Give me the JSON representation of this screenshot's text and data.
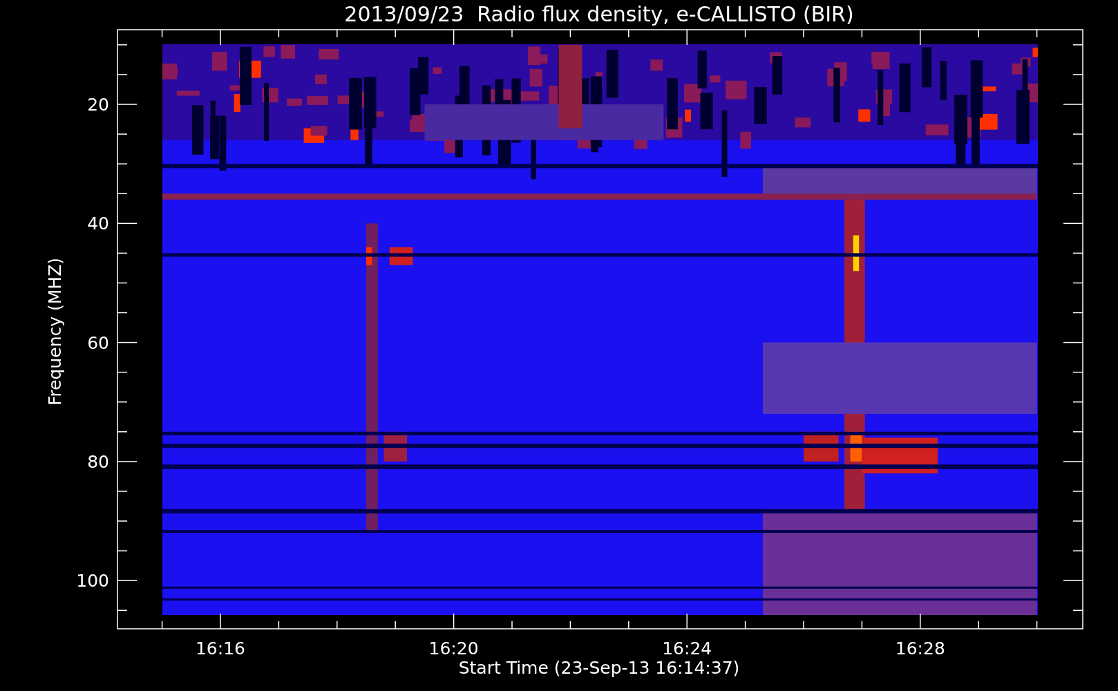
{
  "plot": {
    "title": "2013/09/23  Radio flux density, e-CALLISTO (BIR)",
    "xlabel": "Start Time (23-Sep-13 16:14:37)",
    "ylabel": "Frequency (MHZ)",
    "x_tick_labels": [
      "16:16",
      "16:20",
      "16:24",
      "16:28"
    ],
    "y_tick_labels": [
      "20",
      "40",
      "60",
      "80",
      "100"
    ]
  }
}
